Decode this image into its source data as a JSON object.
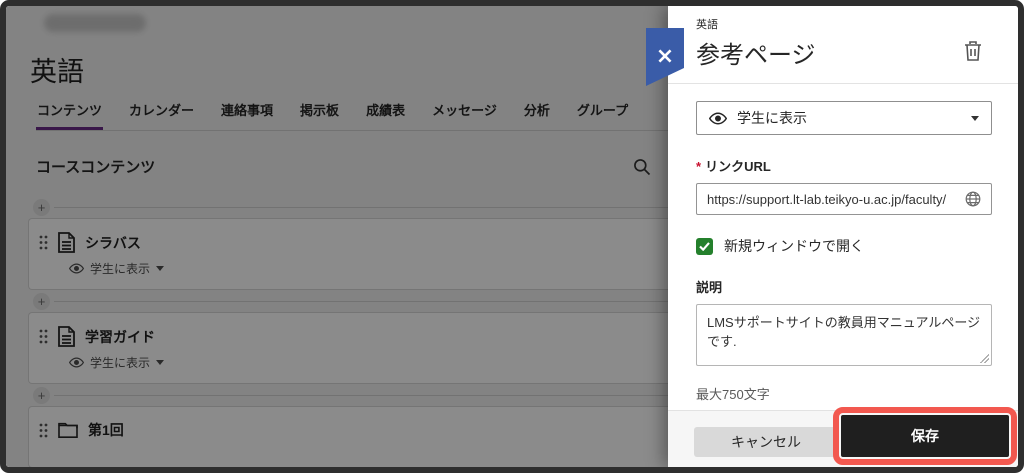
{
  "left_pane": {
    "course_title": "英語",
    "tabs": [
      "コンテンツ",
      "カレンダー",
      "連絡事項",
      "掲示板",
      "成績表",
      "メッセージ",
      "分析",
      "グループ"
    ],
    "active_tab": "コンテンツ",
    "content_header": "コースコンテンツ",
    "items": [
      {
        "icon": "document-icon",
        "title": "シラバス",
        "visibility": "学生に表示"
      },
      {
        "icon": "document-icon",
        "title": "学習ガイド",
        "visibility": "学生に表示"
      },
      {
        "icon": "folder-icon",
        "title": "第1回"
      }
    ]
  },
  "panel": {
    "context": "英語",
    "title": "参考ページ",
    "visibility_select": {
      "value": "学生に表示"
    },
    "link_url": {
      "label": "リンクURL",
      "required_marker": "*",
      "value": "https://support.lt-lab.teikyo-u.ac.jp/faculty/"
    },
    "open_new_window": {
      "label": "新規ウィンドウで開く",
      "checked": true
    },
    "description": {
      "label": "説明",
      "value": "LMSサポートサイトの教員用マニュアルページです.",
      "max_note": "最大750文字"
    },
    "footer": {
      "cancel_label": "キャンセル",
      "save_label": "保存"
    }
  },
  "colors": {
    "accent_purple": "#682A85",
    "close_blue": "#3A5CA8",
    "checkbox_green": "#24802C",
    "annotation_red": "#F2584F",
    "save_black": "#1F1F1F"
  }
}
